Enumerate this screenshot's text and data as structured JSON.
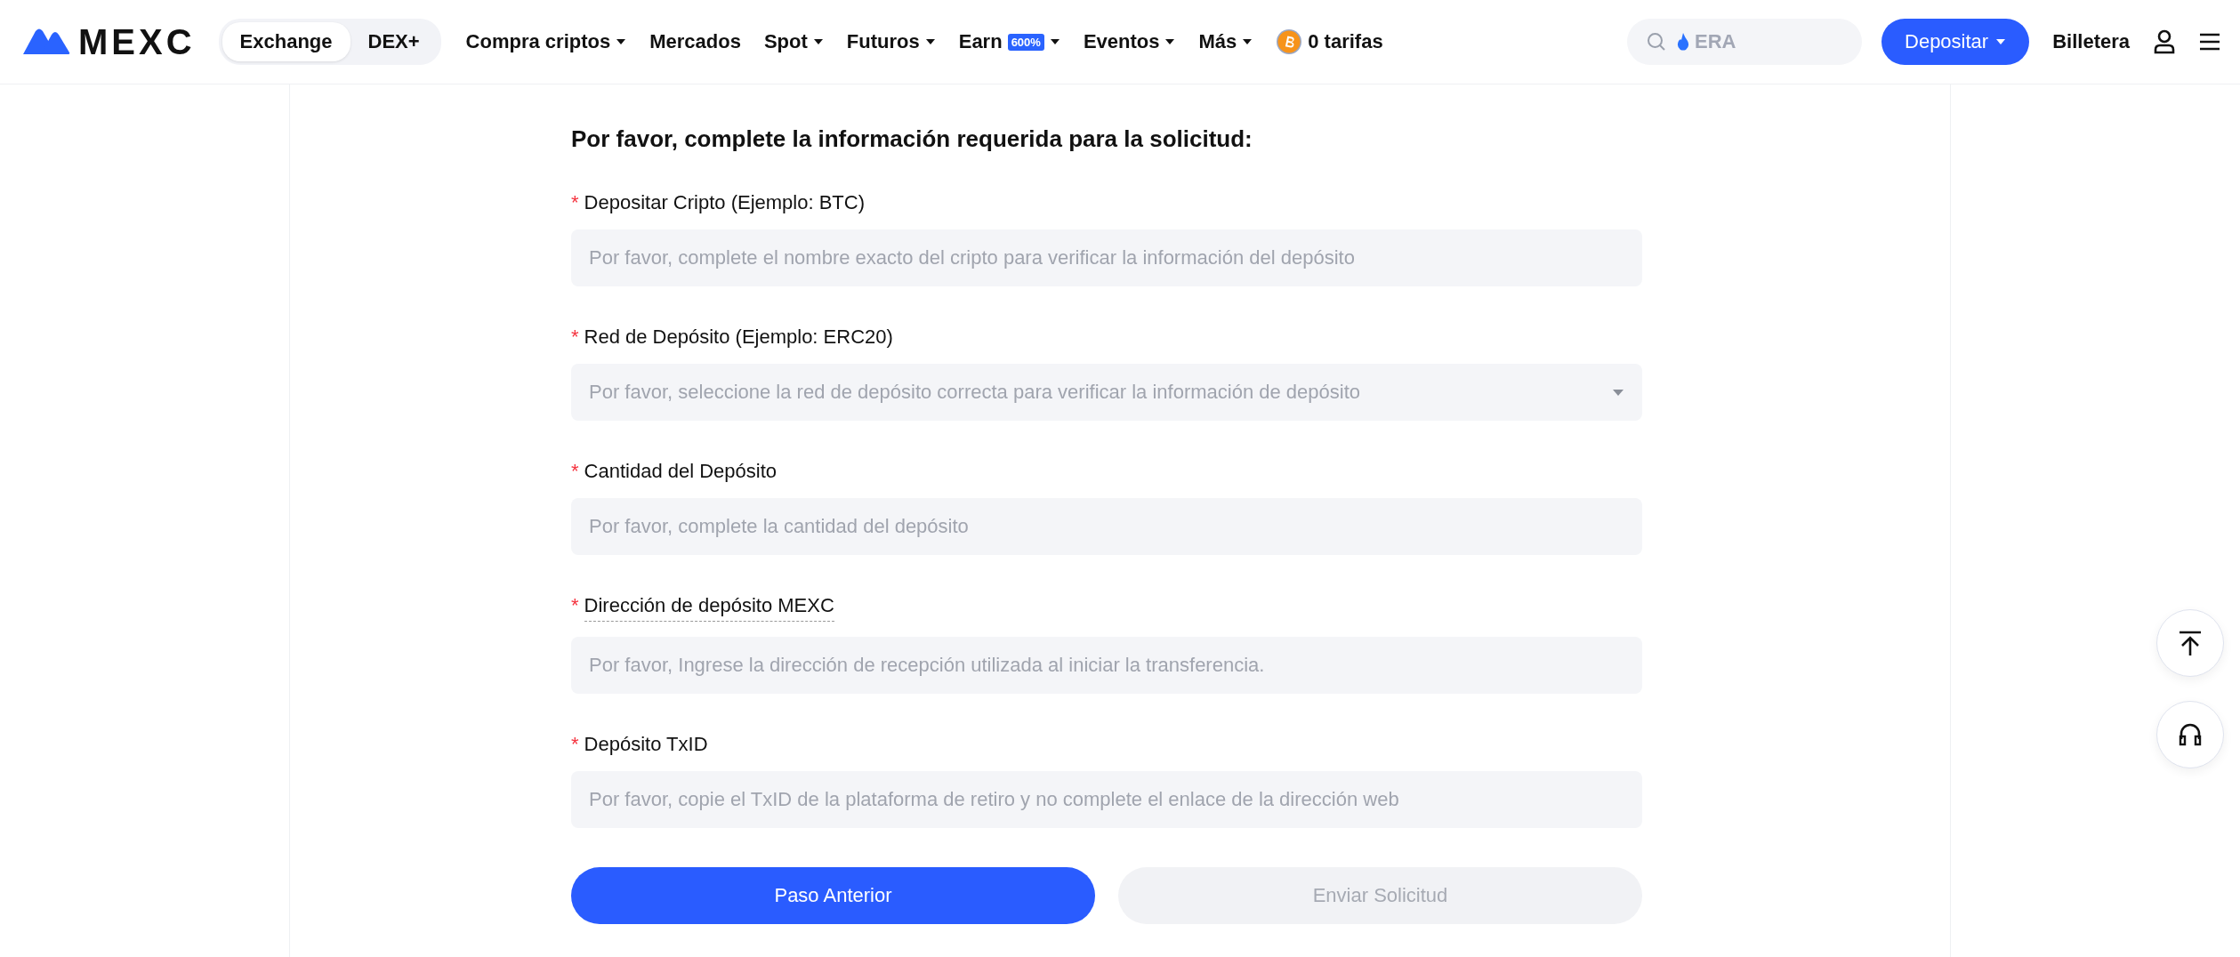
{
  "header": {
    "logo": "MEXC",
    "segments": [
      {
        "label": "Exchange",
        "selected": true
      },
      {
        "label": "DEX+",
        "selected": false
      }
    ],
    "nav": [
      {
        "label": "Compra criptos",
        "dropdown": true
      },
      {
        "label": "Mercados",
        "dropdown": false
      },
      {
        "label": "Spot",
        "dropdown": true
      },
      {
        "label": "Futuros",
        "dropdown": true
      },
      {
        "label": "Earn",
        "badge": "600%",
        "dropdown": true
      },
      {
        "label": "Eventos",
        "dropdown": true
      },
      {
        "label": "Más",
        "dropdown": true
      }
    ],
    "fees": "0 tarifas",
    "search": {
      "placeholder": "ERA"
    },
    "deposit_button": "Depositar",
    "wallet": "Billetera"
  },
  "form": {
    "title": "Por favor, complete la información requerida para la solicitud:",
    "fields": [
      {
        "label": "Depositar Cripto (Ejemplo: BTC)",
        "required": "*",
        "tooltip": false,
        "kind": "text",
        "placeholder": "Por favor, complete el nombre exacto del cripto para verificar la información del depósito"
      },
      {
        "label": "Red de Depósito (Ejemplo: ERC20)",
        "required": "*",
        "tooltip": false,
        "kind": "select",
        "placeholder": "Por favor, seleccione la red de depósito correcta para verificar la información de depósito"
      },
      {
        "label": "Cantidad del Depósito",
        "required": "*",
        "tooltip": false,
        "kind": "text",
        "placeholder": "Por favor, complete la cantidad del depósito"
      },
      {
        "label": "Dirección de depósito MEXC",
        "required": "*",
        "tooltip": true,
        "kind": "text",
        "placeholder": "Por favor, Ingrese la dirección de recepción utilizada al iniciar la transferencia."
      },
      {
        "label": "Depósito TxID",
        "required": "*",
        "tooltip": false,
        "kind": "text",
        "placeholder": "Por favor, copie el TxID de la plataforma de retiro y no complete el enlace de la dirección web"
      }
    ],
    "buttons": [
      {
        "label": "Paso Anterior",
        "disabled": false
      },
      {
        "label": "Enviar Solicitud",
        "disabled": true
      }
    ]
  }
}
